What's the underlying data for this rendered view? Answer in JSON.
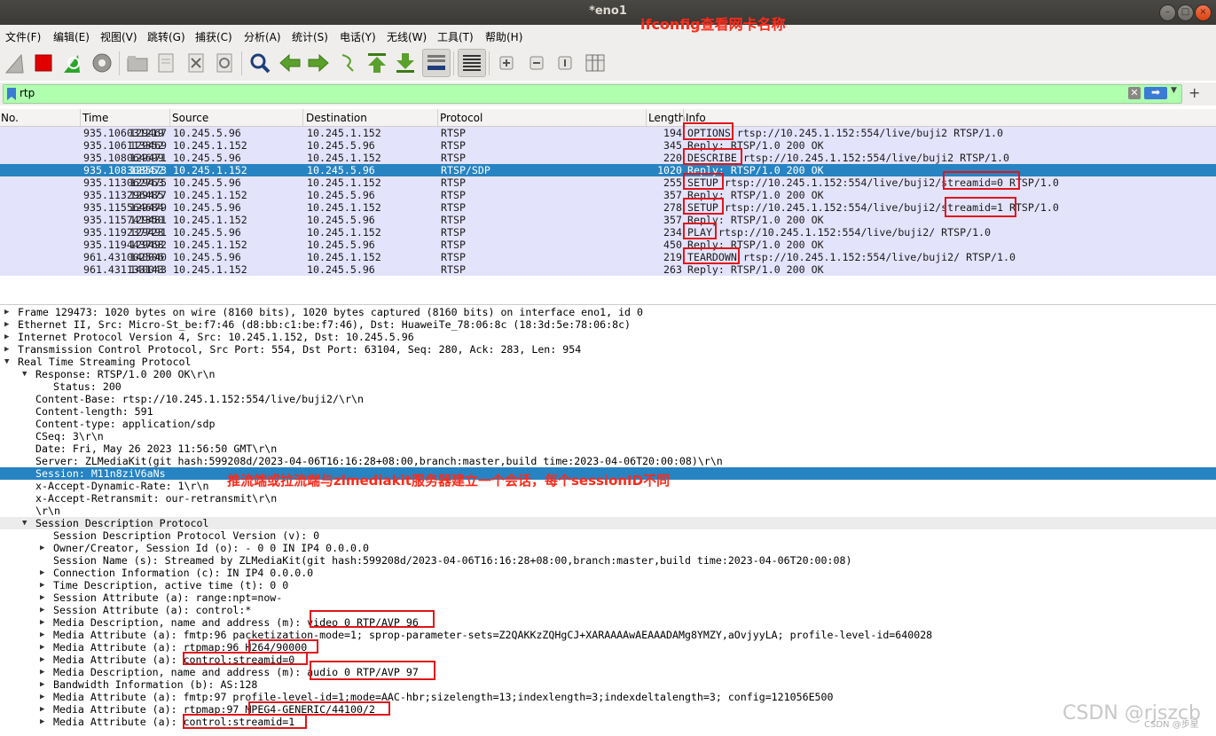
{
  "window": {
    "title": "*eno1"
  },
  "menu": [
    "文件(F)",
    "编辑(E)",
    "视图(V)",
    "跳转(G)",
    "捕获(C)",
    "分析(A)",
    "统计(S)",
    "电话(Y)",
    "无线(W)",
    "工具(T)",
    "帮助(H)"
  ],
  "annotations": {
    "top": "ifconfig查看网卡名称",
    "session": "推流端或拉流端与zlmediakit服务器建立一个会话，每个sessionID不同"
  },
  "toolbar": {
    "icons": [
      "shark-fin-start-icon",
      "stop-square-icon",
      "restart-icon",
      "options-gear-icon",
      "open-folder-icon",
      "save-file-icon",
      "close-file-icon",
      "reload-icon",
      "find-magnifier-icon",
      "back-arrow-icon",
      "forward-arrow-icon",
      "goto-packet-icon",
      "first-packet-icon",
      "last-packet-icon",
      "autoscroll-icon",
      "colorize-icon",
      "zoom-in-icon",
      "zoom-out-icon",
      "normal-size-icon",
      "resize-columns-icon"
    ]
  },
  "filter": {
    "value": "rtp"
  },
  "packet_list": {
    "columns": [
      "No.",
      "Time",
      "Source",
      "Destination",
      "Protocol",
      "Length",
      "Info"
    ],
    "rows": [
      {
        "no": "129467",
        "time": "935.106031219",
        "src": "10.245.5.96",
        "dst": "10.245.1.152",
        "proto": "RTSP",
        "len": "194",
        "info": "OPTIONS rtsp://10.245.1.152:554/live/buji2 RTSP/1.0"
      },
      {
        "no": "129469",
        "time": "935.106113352",
        "src": "10.245.1.152",
        "dst": "10.245.5.96",
        "proto": "RTSP",
        "len": "345",
        "info": "Reply: RTSP/1.0 200 OK"
      },
      {
        "no": "129471",
        "time": "935.108064699",
        "src": "10.245.5.96",
        "dst": "10.245.1.152",
        "proto": "RTSP",
        "len": "220",
        "info": "DESCRIBE rtsp://10.245.1.152:554/live/buji2 RTSP/1.0"
      },
      {
        "no": "129473",
        "time": "935.108308552",
        "src": "10.245.1.152",
        "dst": "10.245.5.96",
        "proto": "RTSP/SDP",
        "len": "1020",
        "info": "Reply: RTSP/1.0 200 OK"
      },
      {
        "no": "129475",
        "time": "935.113062763",
        "src": "10.245.5.96",
        "dst": "10.245.1.152",
        "proto": "RTSP",
        "len": "255",
        "info": "SETUP rtsp://10.245.1.152:554/live/buji2/streamid=0 RTSP/1.0"
      },
      {
        "no": "129477",
        "time": "935.113296485",
        "src": "10.245.1.152",
        "dst": "10.245.5.96",
        "proto": "RTSP",
        "len": "357",
        "info": "Reply: RTSP/1.0 200 OK"
      },
      {
        "no": "129479",
        "time": "935.115564684",
        "src": "10.245.5.96",
        "dst": "10.245.1.152",
        "proto": "RTSP",
        "len": "278",
        "info": "SETUP rtsp://10.245.1.152:554/live/buji2/streamid=1 RTSP/1.0"
      },
      {
        "no": "129481",
        "time": "935.115741350",
        "src": "10.245.1.152",
        "dst": "10.245.5.96",
        "proto": "RTSP",
        "len": "357",
        "info": "Reply: RTSP/1.0 200 OK"
      },
      {
        "no": "129491",
        "time": "935.119237723",
        "src": "10.245.5.96",
        "dst": "10.245.1.152",
        "proto": "RTSP",
        "len": "234",
        "info": "PLAY rtsp://10.245.1.152:554/live/buji2/ RTSP/1.0"
      },
      {
        "no": "129492",
        "time": "935.119443768",
        "src": "10.245.1.152",
        "dst": "10.245.5.96",
        "proto": "RTSP",
        "len": "450",
        "info": "Reply: RTSP/1.0 200 OK"
      },
      {
        "no": "140040",
        "time": "961.431002506",
        "src": "10.245.5.96",
        "dst": "10.245.1.152",
        "proto": "RTSP",
        "len": "219",
        "info": "TEARDOWN rtsp://10.245.1.152:554/live/buji2/ RTSP/1.0"
      },
      {
        "no": "140043",
        "time": "961.431133143",
        "src": "10.245.1.152",
        "dst": "10.245.5.96",
        "proto": "RTSP",
        "len": "263",
        "info": "Reply: RTSP/1.0 200 OK"
      }
    ],
    "selected_no": "129473"
  },
  "details": [
    {
      "t": "Frame 129473: 1020 bytes on wire (8160 bits), 1020 bytes captured (8160 bits) on interface eno1, id 0",
      "lvl": 0,
      "exp": "closed"
    },
    {
      "t": "Ethernet II, Src: Micro-St_be:f7:46 (d8:bb:c1:be:f7:46), Dst: HuaweiTe_78:06:8c (18:3d:5e:78:06:8c)",
      "lvl": 0,
      "exp": "closed"
    },
    {
      "t": "Internet Protocol Version 4, Src: 10.245.1.152, Dst: 10.245.5.96",
      "lvl": 0,
      "exp": "closed"
    },
    {
      "t": "Transmission Control Protocol, Src Port: 554, Dst Port: 63104, Seq: 280, Ack: 283, Len: 954",
      "lvl": 0,
      "exp": "closed"
    },
    {
      "t": "Real Time Streaming Protocol",
      "lvl": 0,
      "exp": "open"
    },
    {
      "t": "Response: RTSP/1.0 200 OK\\r\\n",
      "lvl": 1,
      "exp": "open"
    },
    {
      "t": "Status: 200",
      "lvl": 2,
      "exp": "none"
    },
    {
      "t": "Content-Base: rtsp://10.245.1.152:554/live/buji2/\\r\\n",
      "lvl": 1,
      "exp": "none"
    },
    {
      "t": "Content-length: 591",
      "lvl": 1,
      "exp": "none"
    },
    {
      "t": "Content-type: application/sdp",
      "lvl": 1,
      "exp": "none"
    },
    {
      "t": "CSeq: 3\\r\\n",
      "lvl": 1,
      "exp": "none"
    },
    {
      "t": "Date: Fri, May 26 2023 11:56:50 GMT\\r\\n",
      "lvl": 1,
      "exp": "none"
    },
    {
      "t": "Server: ZLMediaKit(git hash:599208d/2023-04-06T16:16:28+08:00,branch:master,build time:2023-04-06T20:00:08)\\r\\n",
      "lvl": 1,
      "exp": "none"
    },
    {
      "t": "Session: M11n8ziV6aNs",
      "lvl": 1,
      "exp": "none",
      "sel": true
    },
    {
      "t": "x-Accept-Dynamic-Rate: 1\\r\\n",
      "lvl": 1,
      "exp": "none"
    },
    {
      "t": "x-Accept-Retransmit: our-retransmit\\r\\n",
      "lvl": 1,
      "exp": "none"
    },
    {
      "t": "\\r\\n",
      "lvl": 1,
      "exp": "none"
    },
    {
      "t": "Session Description Protocol",
      "lvl": 1,
      "exp": "open",
      "shade": true
    },
    {
      "t": "Session Description Protocol Version (v): 0",
      "lvl": 2,
      "exp": "none"
    },
    {
      "t": "Owner/Creator, Session Id (o): - 0 0 IN IP4 0.0.0.0",
      "lvl": 2,
      "exp": "closed"
    },
    {
      "t": "Session Name (s): Streamed by ZLMediaKit(git hash:599208d/2023-04-06T16:16:28+08:00,branch:master,build time:2023-04-06T20:00:08)",
      "lvl": 2,
      "exp": "none"
    },
    {
      "t": "Connection Information (c): IN IP4 0.0.0.0",
      "lvl": 2,
      "exp": "closed"
    },
    {
      "t": "Time Description, active time (t): 0 0",
      "lvl": 2,
      "exp": "closed"
    },
    {
      "t": "Session Attribute (a): range:npt=now-",
      "lvl": 2,
      "exp": "closed"
    },
    {
      "t": "Session Attribute (a): control:*",
      "lvl": 2,
      "exp": "closed"
    },
    {
      "t": "Media Description, name and address (m): video 0 RTP/AVP 96",
      "lvl": 2,
      "exp": "closed"
    },
    {
      "t": "Media Attribute (a): fmtp:96 packetization-mode=1; sprop-parameter-sets=Z2QAKKzZQHgCJ+XARAAAAwAEAAADAMg8YMZY,aOvjyyLA; profile-level-id=640028",
      "lvl": 2,
      "exp": "closed"
    },
    {
      "t": "Media Attribute (a): rtpmap:96 H264/90000",
      "lvl": 2,
      "exp": "closed"
    },
    {
      "t": "Media Attribute (a): control:streamid=0",
      "lvl": 2,
      "exp": "closed"
    },
    {
      "t": "Media Description, name and address (m): audio 0 RTP/AVP 97",
      "lvl": 2,
      "exp": "closed"
    },
    {
      "t": "Bandwidth Information (b): AS:128",
      "lvl": 2,
      "exp": "closed"
    },
    {
      "t": "Media Attribute (a): fmtp:97 profile-level-id=1;mode=AAC-hbr;sizelength=13;indexlength=3;indexdeltalength=3; config=121056E500",
      "lvl": 2,
      "exp": "closed"
    },
    {
      "t": "Media Attribute (a): rtpmap:97 MPEG4-GENERIC/44100/2",
      "lvl": 2,
      "exp": "closed"
    },
    {
      "t": "Media Attribute (a): control:streamid=1",
      "lvl": 2,
      "exp": "closed"
    }
  ],
  "watermark": "CSDN @rjszcb",
  "watermark_small": "CSDN @步星",
  "colors": {
    "selected": "#2783c2",
    "row_bg": "#e4e3fc",
    "filter_ok": "#afffaf",
    "annotation": "#ff2a1a"
  }
}
